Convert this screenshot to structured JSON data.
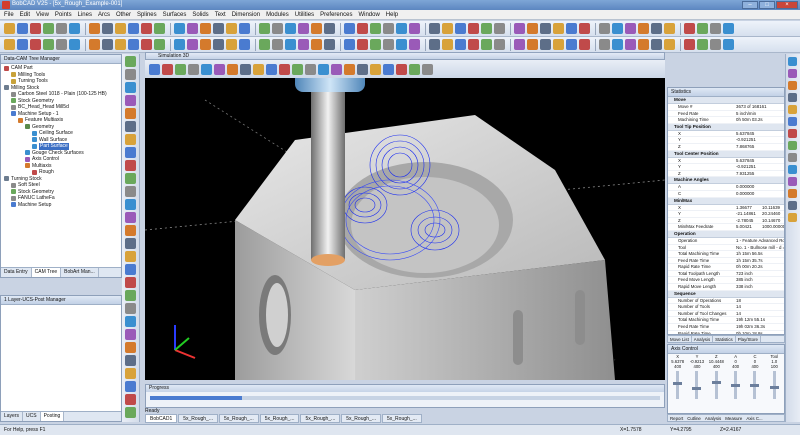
{
  "app": {
    "title": "BobCAD V25 - [5x_Rough_Example-001]"
  },
  "menu": [
    "File",
    "Edit",
    "View",
    "Points",
    "Lines",
    "Arcs",
    "Other",
    "Splines",
    "Surfaces",
    "Solids",
    "Text",
    "Dimension",
    "Modules",
    "Utilities",
    "Preferences",
    "Window",
    "Help"
  ],
  "toolbar": {
    "all_label": "ALL"
  },
  "tree": {
    "header": "Data-CAM Tree Manager",
    "items": [
      {
        "label": "CAM Part",
        "depth": 0,
        "color": "#c04a4a"
      },
      {
        "label": "Milling Tools",
        "depth": 1,
        "color": "#c8a23a"
      },
      {
        "label": "Turning Tools",
        "depth": 1,
        "color": "#c8a23a"
      },
      {
        "label": "Milling Stock",
        "depth": 0,
        "color": "#6d7c8f"
      },
      {
        "label": "Carbon Steel 1018 - Plain (100-125 HB)",
        "depth": 1,
        "color": "#8a8a8a"
      },
      {
        "label": "Stock Geometry",
        "depth": 1,
        "color": "#6aa85c"
      },
      {
        "label": "BC_Head_Head Mill5d",
        "depth": 1,
        "color": "#8a8a8a"
      },
      {
        "label": "Machine Setup - 1",
        "depth": 1,
        "color": "#4a7bd0"
      },
      {
        "label": "Feature Multiaxis",
        "depth": 2,
        "color": "#d47a2c"
      },
      {
        "label": "Geometry",
        "depth": 3,
        "color": "#5a8a4a"
      },
      {
        "label": "Ceiling Surface",
        "depth": 4,
        "color": "#3a8fd0"
      },
      {
        "label": "Wall Surface",
        "depth": 4,
        "color": "#3a8fd0"
      },
      {
        "label": "Part Surface",
        "depth": 4,
        "color": "#3a8fd0",
        "selected": true
      },
      {
        "label": "Gouge Check Surfaces",
        "depth": 3,
        "color": "#3a8fd0"
      },
      {
        "label": "Axis Control",
        "depth": 3,
        "color": "#9a5ab8"
      },
      {
        "label": "Multiaxis",
        "depth": 3,
        "color": "#d47a2c"
      },
      {
        "label": "Rough",
        "depth": 4,
        "color": "#c04a4a"
      },
      {
        "label": "Turning Stock",
        "depth": 0,
        "color": "#6d7c8f"
      },
      {
        "label": "Soft Steel",
        "depth": 1,
        "color": "#8a8a8a"
      },
      {
        "label": "Stock Geometry",
        "depth": 1,
        "color": "#6aa85c"
      },
      {
        "label": "FANUC LatheFa",
        "depth": 1,
        "color": "#8a8a8a"
      },
      {
        "label": "Machine Setup",
        "depth": 1,
        "color": "#4a7bd0"
      }
    ],
    "tabs": [
      "Data Entry",
      "CAM Tree",
      "BobArt Man..."
    ]
  },
  "layer_panel": {
    "header": "1 Layer-UCS-Post Manager",
    "tabs": [
      "Layers",
      "UCS",
      "Posting"
    ]
  },
  "viewport": {
    "title": "Simulation 3D"
  },
  "stats": {
    "header": "Statistics",
    "sections": [
      {
        "title": "Move",
        "rows": [
          [
            "Move #",
            "3673 of 168161"
          ],
          [
            "Feed Rate",
            "5 inch/min"
          ],
          [
            "Machining Time",
            "0h 50m 03.2s"
          ]
        ]
      },
      {
        "title": "Tool Tip Position",
        "rows": [
          [
            "X",
            "5.637845"
          ],
          [
            "Y",
            "-0.921251"
          ],
          [
            "Z",
            "7.868765"
          ]
        ]
      },
      {
        "title": "Tool Center Position",
        "rows": [
          [
            "X",
            "5.637845"
          ],
          [
            "Y",
            "-0.921251"
          ],
          [
            "Z",
            "7.931255"
          ]
        ]
      },
      {
        "title": "Machine Angles",
        "rows": [
          [
            "A",
            "0.000000"
          ],
          [
            "C",
            "0.000000"
          ]
        ]
      },
      {
        "title": "Min/Max",
        "rows": [
          [
            "X",
            "1.36677",
            "10.11639"
          ],
          [
            "Y",
            "-21.14861",
            "20.24460"
          ],
          [
            "Z",
            "-2.78045",
            "10.14670"
          ],
          [
            "Min/Max Feedrate",
            "5.00421",
            "1000.00000"
          ]
        ]
      },
      {
        "title": "Operation",
        "rows": [
          [
            "Operation",
            "1 - Feature Advanced Rou..."
          ],
          [
            "Tool",
            "No. 1 - Bullnose mill - d = 0..."
          ],
          [
            "Total Machining Time",
            "1h 15m 56.5s"
          ],
          [
            "Feed Rate Time",
            "1h 15m 35.7s"
          ],
          [
            "Rapid Rate Time",
            "0h 00m 20.2s"
          ],
          [
            "Total Toolpath Length",
            "723 inch"
          ],
          [
            "Feed Move Length",
            "385 inch"
          ],
          [
            "Rapid Move Length",
            "338 inch"
          ]
        ]
      },
      {
        "title": "Sequence",
        "rows": [
          [
            "Number of Operations",
            "18"
          ],
          [
            "Number of Tools",
            "14"
          ],
          [
            "Number of Tool Changes",
            "14"
          ],
          [
            "Total Machining Time",
            "19h 12m 55.1s"
          ],
          [
            "Feed Rate Time",
            "19h 02m 36.3s"
          ],
          [
            "Rapid Rate Time",
            "0h 10m 18.8s"
          ],
          [
            "Total Toolpath Length",
            "14909 inch"
          ],
          [
            "Rapid Move Length",
            "4437 inch"
          ]
        ]
      }
    ]
  },
  "stats_tabs": [
    "Move List",
    "Analysis",
    "Statistics",
    "Play/Store"
  ],
  "axis_control": {
    "header": "Axis Control",
    "axes": [
      "X",
      "Y",
      "Z",
      "A",
      "C",
      "Tool"
    ],
    "values": [
      "5.6378",
      "-0.9213",
      "10.4448",
      "0",
      "0",
      "1.0"
    ],
    "mins": [
      "400",
      "400",
      "400",
      "400",
      "400",
      "100"
    ],
    "levels": [
      0.55,
      0.35,
      0.62,
      0.5,
      0.5,
      0.4
    ]
  },
  "bottom_tabs": [
    "Report",
    "Cutline",
    "Analysis",
    "Measure",
    "Axis C..."
  ],
  "progress": {
    "label": "Progress",
    "fraction": 0.18,
    "ready": "Ready"
  },
  "doc_tabs": [
    "BobCAD1",
    "5x_Rough_...",
    "5x_Rough_...",
    "5x_Rough_...",
    "5x_Rough_...",
    "5x_Rough_...",
    "5x_Rough_..."
  ],
  "status": {
    "help": "For Help, press F1",
    "x": "X=1.7578",
    "y": "Y=4.2795",
    "z": "Z=2.4167"
  }
}
